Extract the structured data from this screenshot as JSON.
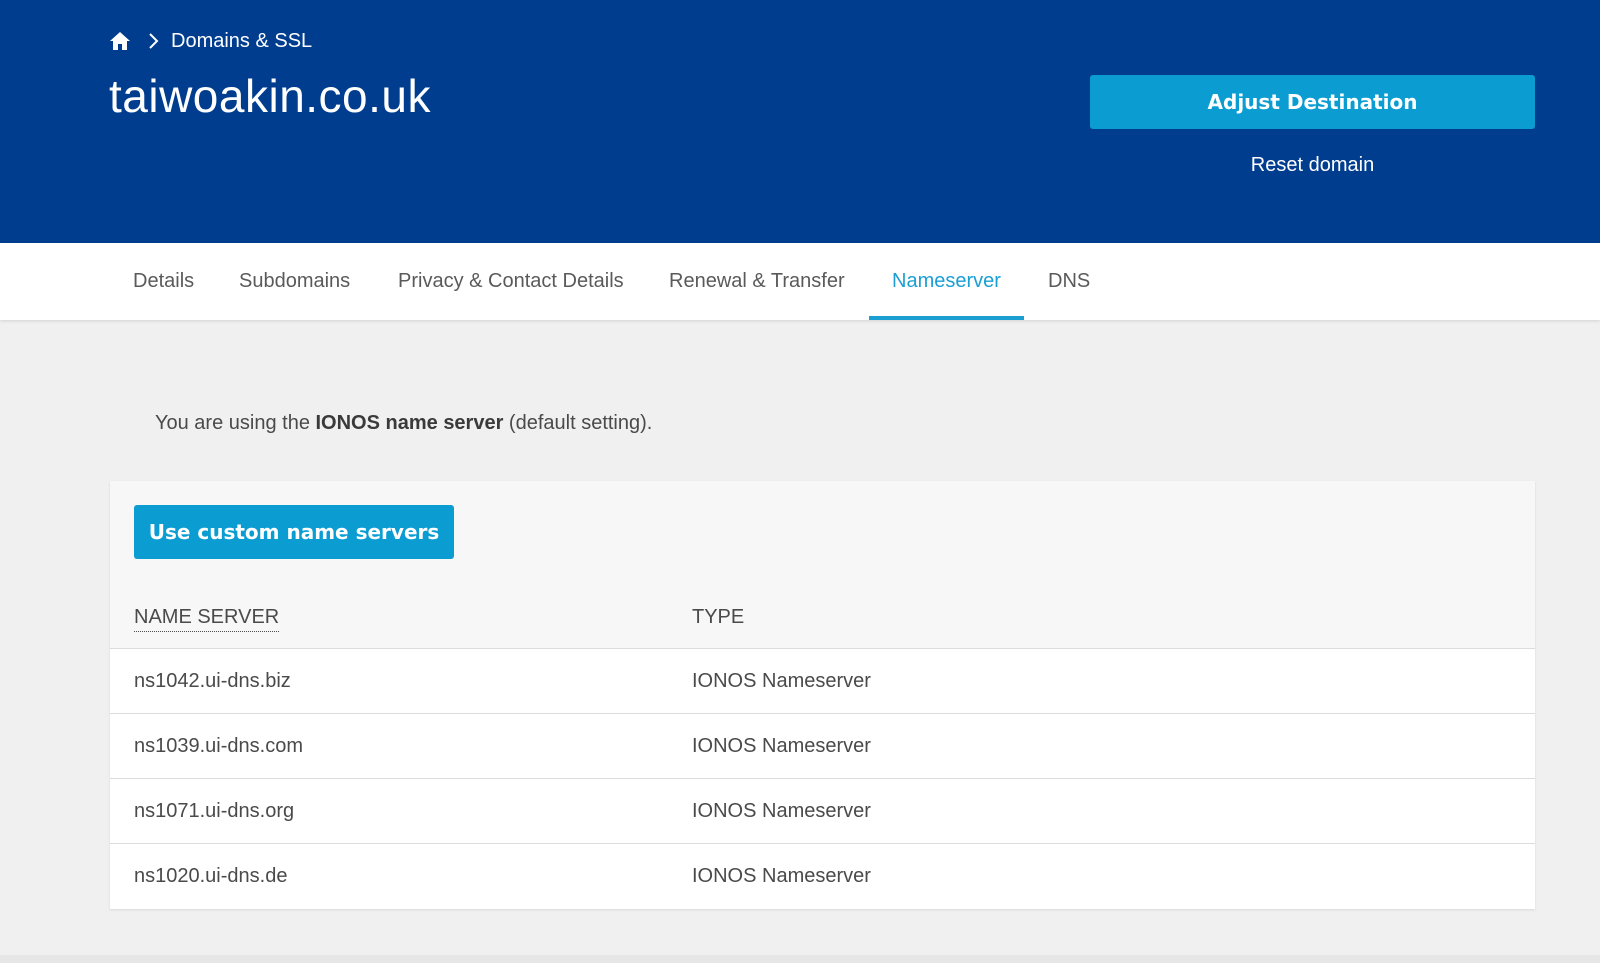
{
  "colors": {
    "header_bg": "#003d8f",
    "accent": "#0b9dd1",
    "active_tab": "#1b9fd3",
    "page_bg": "#f0f0f0"
  },
  "header": {
    "home_icon": "home-icon",
    "breadcrumb_separator_icon": "chevron-right-icon",
    "breadcrumb_label": "Domains & SSL",
    "title": "taiwoakin.co.uk",
    "adjust_button_label": "Adjust Destination",
    "reset_link_label": "Reset domain"
  },
  "tabs": [
    {
      "label": "Details",
      "active": false
    },
    {
      "label": "Subdomains",
      "active": false
    },
    {
      "label": "Privacy & Contact Details",
      "active": false
    },
    {
      "label": "Renewal & Transfer",
      "active": false
    },
    {
      "label": "Nameserver",
      "active": true
    },
    {
      "label": "DNS",
      "active": false
    }
  ],
  "info": {
    "prefix": "You are using the ",
    "bold": "IONOS name server",
    "suffix": " (default setting)."
  },
  "panel": {
    "custom_button_label": "Use custom name servers",
    "columns": [
      "NAME SERVER",
      "TYPE"
    ],
    "rows": [
      {
        "name": "ns1042.ui-dns.biz",
        "type": "IONOS Nameserver"
      },
      {
        "name": "ns1039.ui-dns.com",
        "type": "IONOS Nameserver"
      },
      {
        "name": "ns1071.ui-dns.org",
        "type": "IONOS Nameserver"
      },
      {
        "name": "ns1020.ui-dns.de",
        "type": "IONOS Nameserver"
      }
    ]
  }
}
